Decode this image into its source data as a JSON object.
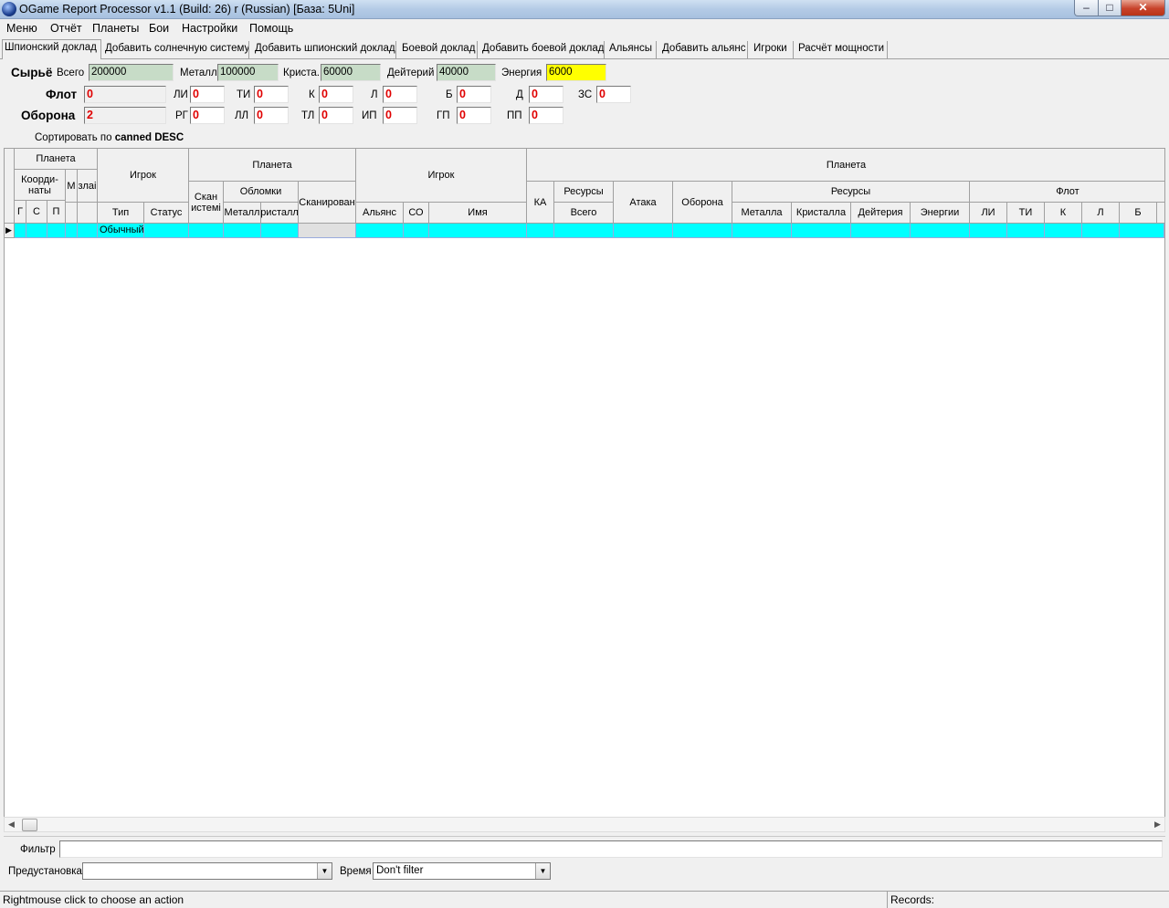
{
  "window": {
    "title": "OGame Report Processor v1.1 (Build: 26) r (Russian) [База: 5Uni]",
    "min": "–",
    "max": "□",
    "close": "✕"
  },
  "menu": [
    "Меню",
    "Отчёт",
    "Планеты",
    "Бои",
    "Настройки",
    "Помощь"
  ],
  "tabs": [
    "Шпионский доклад",
    "Добавить солнечную систему",
    "Добавить шпионский доклад",
    "Боевой доклад",
    "Добавить боевой доклад",
    "Альянсы",
    "Добавить альянс",
    "Игроки",
    "Расчёт мощности"
  ],
  "resources": {
    "title": "Сырьё",
    "total_label": "Всего",
    "total": "200000",
    "metal_label": "Металл",
    "metal": "100000",
    "crystal_label": "Криста.",
    "crystal": "60000",
    "deut_label": "Дейтерий",
    "deut": "40000",
    "energy_label": "Энергия",
    "energy": "6000"
  },
  "fleet": {
    "title": "Флот",
    "total": "0",
    "items": [
      {
        "l": "ЛИ",
        "v": "0"
      },
      {
        "l": "ТИ",
        "v": "0"
      },
      {
        "l": "К",
        "v": "0"
      },
      {
        "l": "Л",
        "v": "0"
      },
      {
        "l": "Б",
        "v": "0"
      },
      {
        "l": "Д",
        "v": "0"
      },
      {
        "l": "ЗС",
        "v": "0"
      }
    ]
  },
  "defense": {
    "title": "Оборона",
    "total": "2",
    "items": [
      {
        "l": "РГ",
        "v": "0"
      },
      {
        "l": "ЛЛ",
        "v": "0"
      },
      {
        "l": "ТЛ",
        "v": "0"
      },
      {
        "l": "ИП",
        "v": "0"
      },
      {
        "l": "ГП",
        "v": "0"
      },
      {
        "l": "ПП",
        "v": "0"
      }
    ]
  },
  "sort": {
    "prefix": "Сортировать по",
    "value": "canned DESC"
  },
  "grid": {
    "planet": "Планета",
    "coords": "Коорди-\nнаты",
    "m": "М",
    "area": "злаі",
    "g": "Г",
    "s": "С",
    "p": "П",
    "player": "Игрок",
    "type": "Тип",
    "status": "Статус",
    "planet2": "Планета",
    "scan": "Скан\nистемі",
    "debris": "Обломки",
    "metal": "Металл",
    "crystal": "ристалл",
    "scanned": "Сканирован",
    "player2": "Игрок",
    "alliance": "Альянс",
    "co": "СО",
    "name": "Имя",
    "planet3": "Планета",
    "ka": "КА",
    "res": "Ресурсы",
    "total": "Всего",
    "attack": "Атака",
    "defense": "Оборона",
    "res2": "Ресурсы",
    "metal2": "Металла",
    "crystal2": "Кристалла",
    "deut2": "Дейтерия",
    "energy2": "Энергии",
    "fleet": "Флот",
    "li": "ЛИ",
    "ti": "ТИ",
    "k": "К",
    "l": "Л",
    "b": "Б",
    "row_type": "Обычный"
  },
  "filter": {
    "label": "Фильтр",
    "value": ""
  },
  "preset": {
    "label": "Предустановка",
    "value": ""
  },
  "time": {
    "label": "Время",
    "value": "Don't filter"
  },
  "status": {
    "hint": "Rightmouse click to choose an action",
    "records": "Records:"
  }
}
